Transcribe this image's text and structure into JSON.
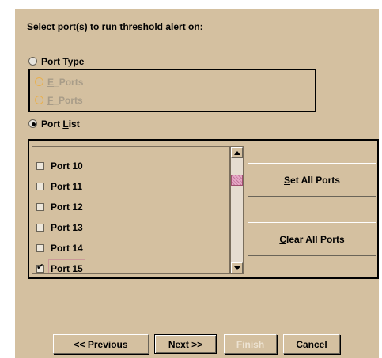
{
  "heading": "Select port(s) to run threshold alert on:",
  "port_type": {
    "label_pre": "P",
    "label_ul": "o",
    "label_post": "rt Type",
    "selected": false,
    "options": [
      {
        "label_ul": "E",
        "label_post": "_Ports",
        "enabled": false
      },
      {
        "label_ul": "F",
        "label_post": "_Ports",
        "enabled": false
      }
    ]
  },
  "port_list": {
    "label_pre": "Port ",
    "label_ul": "L",
    "label_post": "ist",
    "selected": true,
    "items": [
      {
        "label": "Port 10",
        "checked": false
      },
      {
        "label": "Port 11",
        "checked": false
      },
      {
        "label": "Port 12",
        "checked": false
      },
      {
        "label": "Port 13",
        "checked": false
      },
      {
        "label": "Port 14",
        "checked": false
      },
      {
        "label": "Port 15",
        "checked": true
      }
    ]
  },
  "buttons": {
    "set_all": {
      "ul": "S",
      "rest": "et All Ports"
    },
    "clear_all": {
      "ul": "C",
      "rest": "lear All Ports"
    }
  },
  "nav": {
    "previous": {
      "pre": "<< ",
      "ul": "P",
      "rest": "revious"
    },
    "next": {
      "ul": "N",
      "rest": "ext >>"
    },
    "finish": {
      "label": "Finish",
      "enabled": false
    },
    "cancel": {
      "label": "Cancel"
    }
  },
  "colors": {
    "panel_bg": "#d4c0a0",
    "disabled_text": "#a89c88",
    "scroll_thumb": "#d88aac"
  }
}
